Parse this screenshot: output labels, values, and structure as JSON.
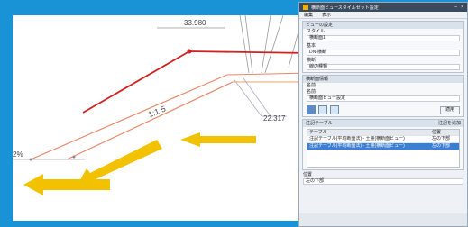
{
  "drawing": {
    "dimensions": {
      "top": "33.980",
      "slope": "1:1.5",
      "right": "22.317",
      "left_edge": "2%"
    }
  },
  "panel": {
    "title": "横断面ビュースタイルセット設定",
    "menu": [
      "編集",
      "表示"
    ],
    "section1_header": "ビューの設定",
    "fields": [
      "スタイル",
      "横断面1",
      "基本",
      "DN-横断",
      "横断",
      "線の種類"
    ],
    "section2_header": "横断面情報",
    "sub_label": "名前",
    "name_label": "名前",
    "name_value": "横断面ビュー設定",
    "apply_button": "適用",
    "section3_header": "注記テーブル",
    "section3_button": "注記を追加",
    "table_headers": [
      "テーブル",
      "位置"
    ],
    "table_rows": [
      {
        "text": "注記テーブル(平均断面法) - 土量(横断面ビュー)",
        "pos": "左の下部"
      },
      {
        "text": "注記テーブル(平均断面法) - 土量(横断面ビュー)",
        "pos": "左の下部"
      }
    ],
    "bottom_label": "位置",
    "bottom_value": "左の下部"
  }
}
